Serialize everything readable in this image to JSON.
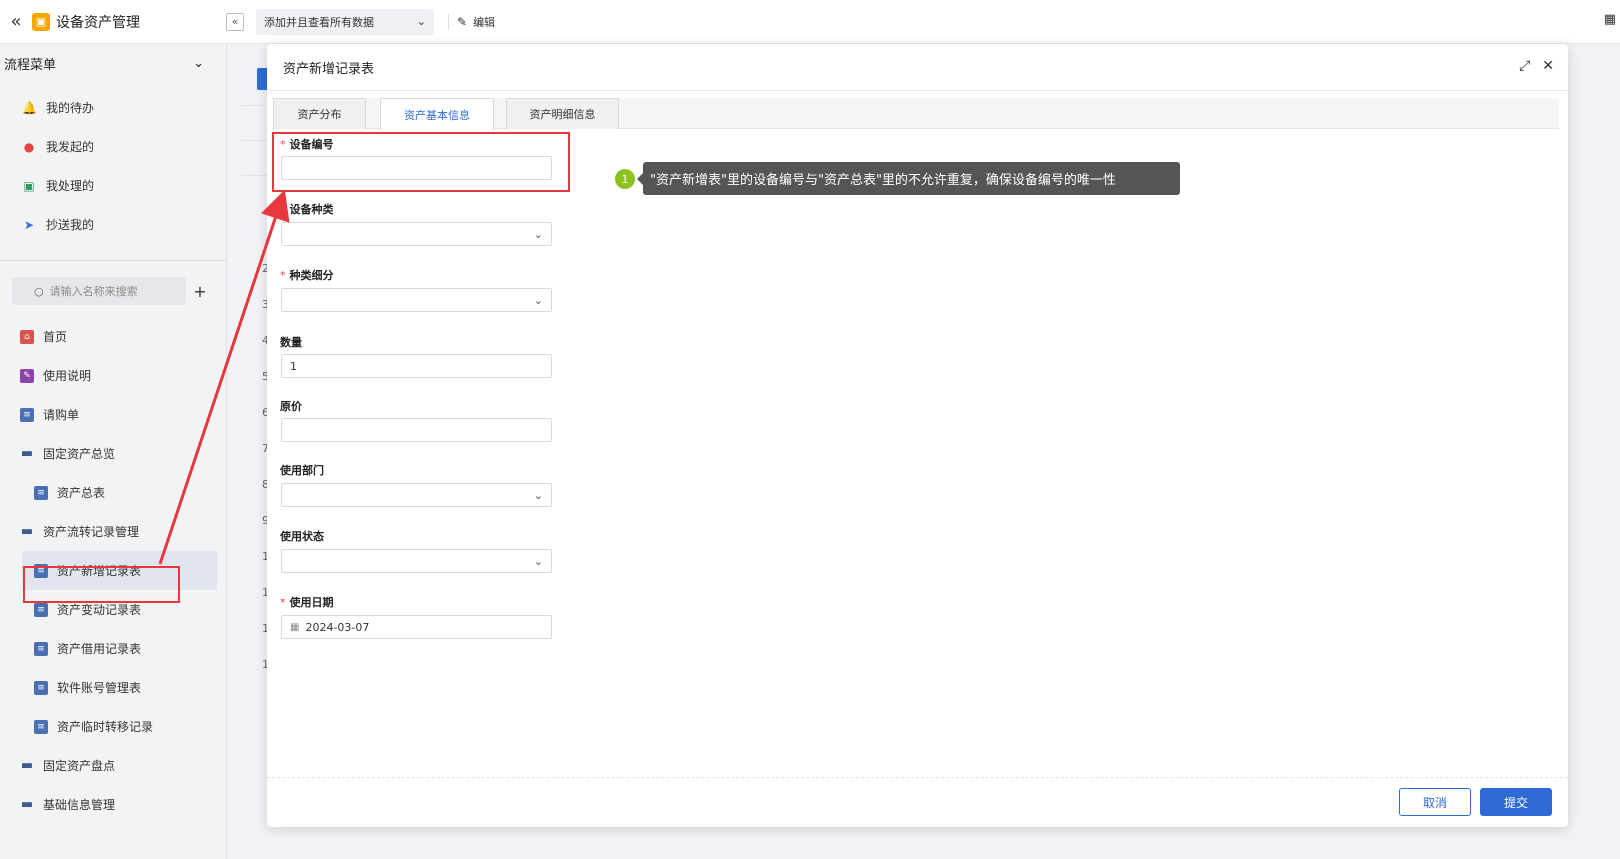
{
  "app": {
    "title": "设备资产管理",
    "logo_icon": "app-logo-icon"
  },
  "toolbar": {
    "view_select": "添加并且查看所有数据",
    "edit_label": "编辑"
  },
  "flow_menu": {
    "title": "流程菜单",
    "items": [
      {
        "label": "我的待办",
        "icon": "bell-icon",
        "color": "#f0a020"
      },
      {
        "label": "我发起的",
        "icon": "play-icon",
        "color": "#e54545"
      },
      {
        "label": "我处理的",
        "icon": "check-icon",
        "color": "#2e9e5a"
      },
      {
        "label": "抄送我的",
        "icon": "send-icon",
        "color": "#3b6fd6"
      }
    ]
  },
  "search": {
    "placeholder": "请输入名称来搜索"
  },
  "nav": {
    "items": [
      {
        "label": "首页",
        "icon": "home-icon"
      },
      {
        "label": "使用说明",
        "icon": "guide-icon"
      },
      {
        "label": "请购单",
        "icon": "doc-icon"
      },
      {
        "label": "固定资产总览",
        "icon": "folder-icon"
      },
      {
        "label": "资产总表",
        "icon": "doc-icon"
      },
      {
        "label": "资产流转记录管理",
        "icon": "folder-icon"
      },
      {
        "label": "资产新增记录表",
        "icon": "doc-icon"
      },
      {
        "label": "资产变动记录表",
        "icon": "doc-icon"
      },
      {
        "label": "资产借用记录表",
        "icon": "doc-icon"
      },
      {
        "label": "软件账号管理表",
        "icon": "doc-icon"
      },
      {
        "label": "资产临时转移记录",
        "icon": "doc-icon"
      },
      {
        "label": "固定资产盘点",
        "icon": "folder-icon"
      },
      {
        "label": "基础信息管理",
        "icon": "folder-icon"
      }
    ]
  },
  "background_rows": [
    "2",
    "3",
    "4",
    "5",
    "6",
    "7",
    "8",
    "9",
    "1",
    "1",
    "1",
    "1"
  ],
  "modal": {
    "title": "资产新增记录表",
    "tabs": [
      "资产分布",
      "资产基本信息",
      "资产明细信息"
    ],
    "active_tab": 1,
    "fields": [
      {
        "label": "设备编号",
        "required": true,
        "type": "text",
        "value": ""
      },
      {
        "label": "设备种类",
        "required": true,
        "type": "select",
        "value": ""
      },
      {
        "label": "种类细分",
        "required": true,
        "type": "select",
        "value": ""
      },
      {
        "label": "数量",
        "required": false,
        "type": "text",
        "value": "1"
      },
      {
        "label": "原价",
        "required": false,
        "type": "text",
        "value": ""
      },
      {
        "label": "使用部门",
        "required": false,
        "type": "select",
        "value": ""
      },
      {
        "label": "使用状态",
        "required": false,
        "type": "select",
        "value": ""
      },
      {
        "label": "使用日期",
        "required": true,
        "type": "date",
        "value": "2024-03-07"
      }
    ],
    "cancel_label": "取消",
    "submit_label": "提交"
  },
  "annotation": {
    "badge": "1",
    "text": "\"资产新增表\"里的设备编号与\"资产总表\"里的不允许重复，确保设备编号的唯一性",
    "highlight_color": "#e8383d"
  }
}
